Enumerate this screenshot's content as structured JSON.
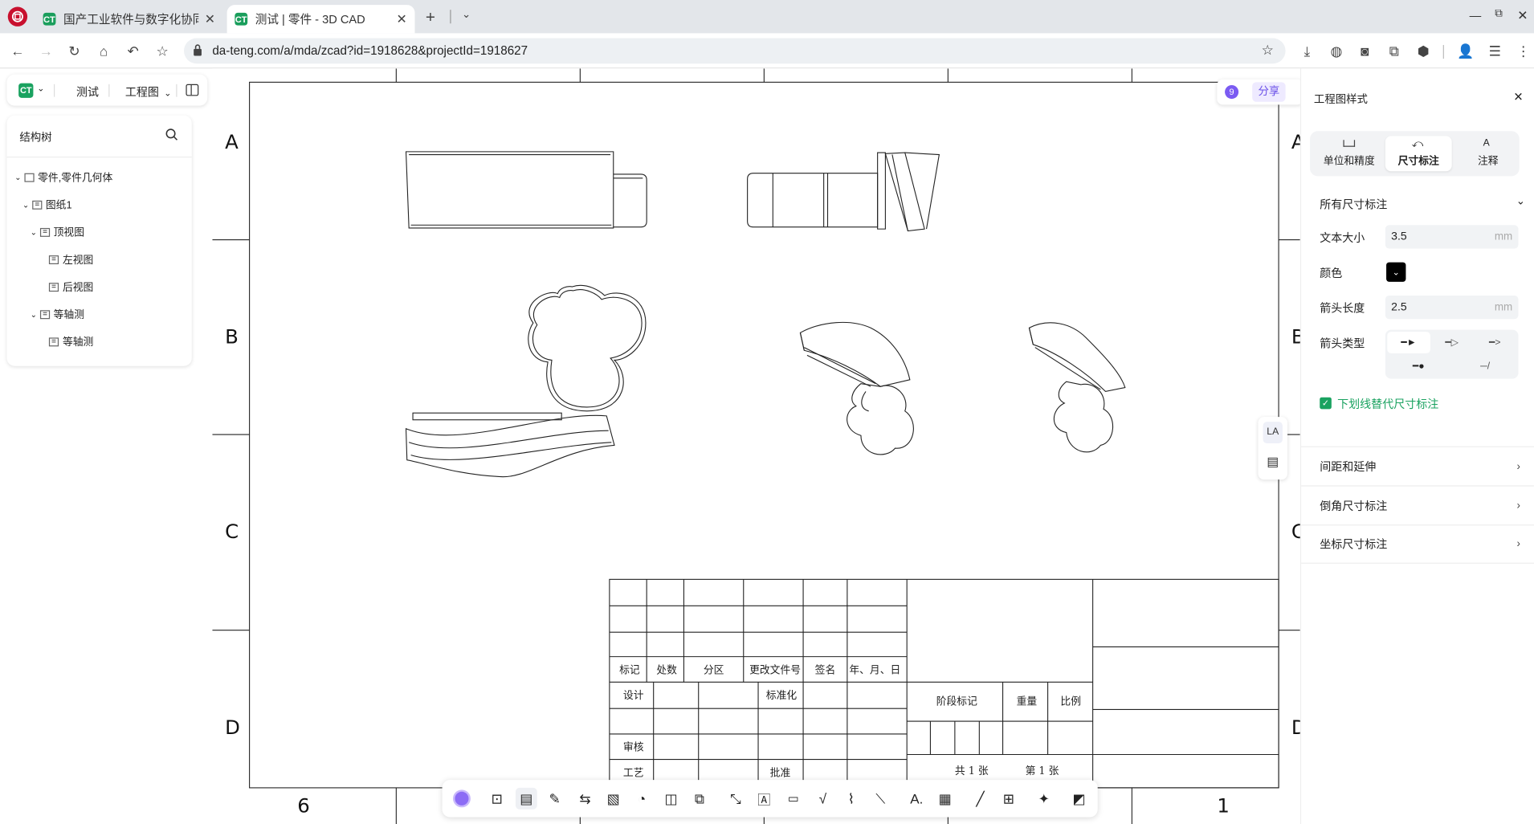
{
  "browser": {
    "tabs": [
      {
        "title": "国产工业软件与数字化协同平",
        "favicon": "CT"
      },
      {
        "title": "测试 | 零件 - 3D CAD",
        "favicon": "CT"
      }
    ],
    "url": "da-teng.com/a/mda/zcad?id=1918628&projectId=1918627"
  },
  "app": {
    "project_name": "测试",
    "mode_label": "工程图"
  },
  "structure_tree": {
    "title": "结构树",
    "items": [
      {
        "label": "零件,零件几何体"
      },
      {
        "label": "图纸1"
      },
      {
        "label": "顶视图"
      },
      {
        "label": "左视图"
      },
      {
        "label": "后视图"
      },
      {
        "label": "等轴测"
      },
      {
        "label": "等轴测"
      }
    ]
  },
  "collab": {
    "user_count": "9",
    "share_label": "分享"
  },
  "drawing": {
    "row_labels": [
      "A",
      "B",
      "C",
      "D"
    ],
    "col_labels_bottom": [
      "6",
      "1"
    ],
    "title_block": {
      "header": [
        "标记",
        "处数",
        "分区",
        "更改文件号",
        "签名",
        "年、月、日"
      ],
      "design": "设计",
      "standardization": "标准化",
      "review": "审核",
      "process": "工艺",
      "approve": "批准",
      "stage_mark": "阶段标记",
      "weight": "重量",
      "scale": "比例",
      "total_sheets": "共 1 张",
      "sheet_no": "第 1 张"
    }
  },
  "style_panel": {
    "title": "工程图样式",
    "tabs": [
      {
        "label": "单位和精度"
      },
      {
        "label": "尺寸标注"
      },
      {
        "label": "注释"
      }
    ],
    "section_all": "所有尺寸标注",
    "text_size_label": "文本大小",
    "text_size_value": "3.5",
    "text_size_unit": "mm",
    "color_label": "颜色",
    "color_value": "#000000",
    "arrow_length_label": "箭头长度",
    "arrow_length_value": "2.5",
    "arrow_length_unit": "mm",
    "arrow_type_label": "箭头类型",
    "underline_label": "下划线替代尺寸标注",
    "underline_checked": true,
    "sections": [
      {
        "label": "间距和延伸"
      },
      {
        "label": "倒角尺寸标注"
      },
      {
        "label": "坐标尺寸标注"
      }
    ]
  },
  "accent_color": "#1aa260"
}
